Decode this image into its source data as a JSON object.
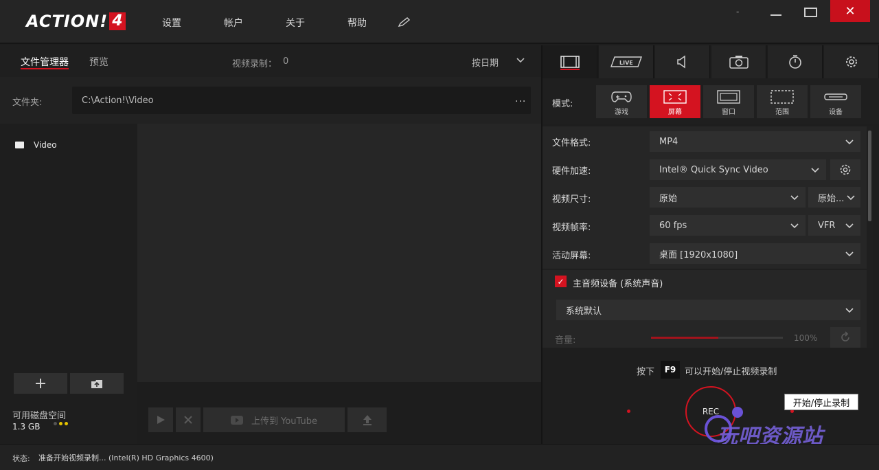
{
  "app": {
    "logo_text": "ACTION!",
    "logo_num": "4",
    "menu": [
      "设置",
      "帐户",
      "关于",
      "帮助"
    ],
    "window_close": "✕"
  },
  "left": {
    "tabs": {
      "files": "文件管理器",
      "preview": "预览"
    },
    "rec_count_label": "视频录制：",
    "rec_count": "0",
    "sort_label": "按日期",
    "folder_label": "文件夹:",
    "folder_path": "C:\\Action!\\Video",
    "folder_more": "...",
    "tree_items": [
      "Video"
    ],
    "disk_label": "可用磁盘空间",
    "disk_value": "1.3 GB",
    "youtube_label": "上传到 YouTube"
  },
  "right": {
    "mode_label": "模式:",
    "modes": [
      {
        "label": "游戏",
        "icon": "gamepad-icon",
        "active": false
      },
      {
        "label": "屏幕",
        "icon": "fullscreen-icon",
        "active": true
      },
      {
        "label": "窗口",
        "icon": "window-icon",
        "active": false
      },
      {
        "label": "范围",
        "icon": "region-icon",
        "active": false
      },
      {
        "label": "设备",
        "icon": "device-icon",
        "active": false
      }
    ],
    "settings": {
      "format_label": "文件格式:",
      "format_value": "MP4",
      "hw_label": "硬件加速:",
      "hw_value": "Intel® Quick Sync Video",
      "size_label": "视频尺寸:",
      "size_value": "原始",
      "size_value2": "原始...",
      "fps_label": "视频帧率:",
      "fps_value": "60 fps",
      "fps_mode": "VFR",
      "screen_label": "活动屏幕:",
      "screen_value": "桌面 [1920x1080]",
      "audio_label": "主音频设备 (系统声音)",
      "audio_checked": true,
      "audio_device": "系统默认",
      "volume_label": "音量:",
      "volume_value": "100%",
      "volume_level": 0.51
    },
    "hint_pre": "按下",
    "hint_key": "F9",
    "hint_post": "可以开始/停止视频录制",
    "rec_label": "REC",
    "tooltip": "开始/停止录制",
    "watermark": "玩吧资源站"
  },
  "status": {
    "label": "状态:",
    "text": "准备开始视频录制... (Intel(R) HD Graphics 4600)"
  },
  "colors": {
    "accent": "#d41320",
    "disk_dots": [
      "#555555",
      "#e5c400",
      "#e5c400"
    ]
  }
}
